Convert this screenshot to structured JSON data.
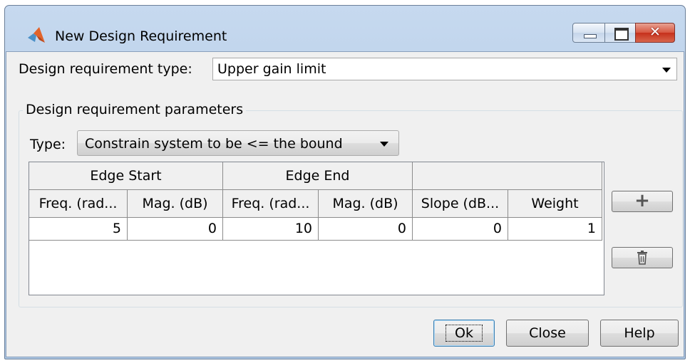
{
  "window": {
    "title": "New Design Requirement"
  },
  "requirement_type": {
    "label": "Design requirement type:",
    "value": "Upper gain limit"
  },
  "parameters": {
    "group_title": "Design requirement parameters",
    "type_label": "Type:",
    "type_value": "Constrain system to be <= the bound"
  },
  "table": {
    "groups": [
      "Edge Start",
      "Edge End",
      ""
    ],
    "columns": [
      "Freq. (rad...",
      "Mag. (dB)",
      "Freq. (rad...",
      "Mag. (dB)",
      "Slope (dB...",
      "Weight"
    ],
    "rows": [
      [
        "5",
        "0",
        "10",
        "0",
        "0",
        "1"
      ]
    ]
  },
  "side_buttons": {
    "add": "+",
    "delete_icon": "trash-icon"
  },
  "buttons": {
    "ok": "Ok",
    "close": "Close",
    "help": "Help"
  },
  "icons": {
    "app": "matlab-icon",
    "minimize": "minimize-icon",
    "maximize": "maximize-icon",
    "close": "close-icon"
  }
}
